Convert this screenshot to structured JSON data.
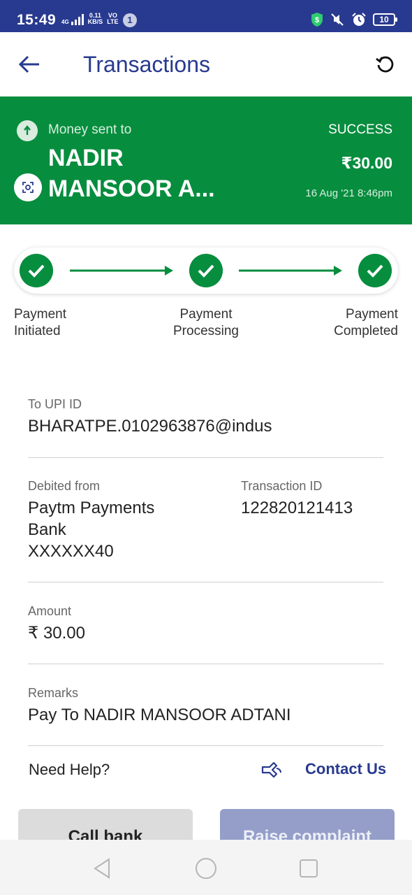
{
  "status_bar": {
    "time": "15:49",
    "network": "4G",
    "speed_value": "0.11",
    "speed_unit": "KB/S",
    "volte_top": "VO",
    "volte_bottom": "LTE",
    "notification_count": "1",
    "battery": "10"
  },
  "app_bar": {
    "title": "Transactions"
  },
  "summary": {
    "direction_label": "Money sent to",
    "payee_line1": "NADIR",
    "payee_line2": "MANSOOR A...",
    "status": "SUCCESS",
    "amount": "₹30.00",
    "datetime": "16 Aug '21 8:46pm",
    "background_color": "#078d3e"
  },
  "tracker": {
    "steps": [
      {
        "line1": "Payment",
        "line2": "Initiated"
      },
      {
        "line1": "Payment",
        "line2": "Processing"
      },
      {
        "line1": "Payment",
        "line2": "Completed"
      }
    ]
  },
  "details": {
    "upi_label": "To UPI ID",
    "upi_value": "BHARATPE.0102963876@indus",
    "debited_label": "Debited from",
    "debited_line1": "Paytm Payments",
    "debited_line2": "Bank",
    "debited_line3": "XXXXXX40",
    "txn_label": "Transaction ID",
    "txn_value": "122820121413",
    "amount_label": "Amount",
    "amount_value": "₹ 30.00",
    "remarks_label": "Remarks",
    "remarks_value": "Pay To NADIR MANSOOR ADTANI"
  },
  "help": {
    "need_help": "Need Help?",
    "contact_us": "Contact Us"
  },
  "actions": {
    "call_bank": "Call bank",
    "raise_complaint": "Raise complaint"
  },
  "colors": {
    "primary": "#283a8f",
    "success": "#078d3e"
  }
}
